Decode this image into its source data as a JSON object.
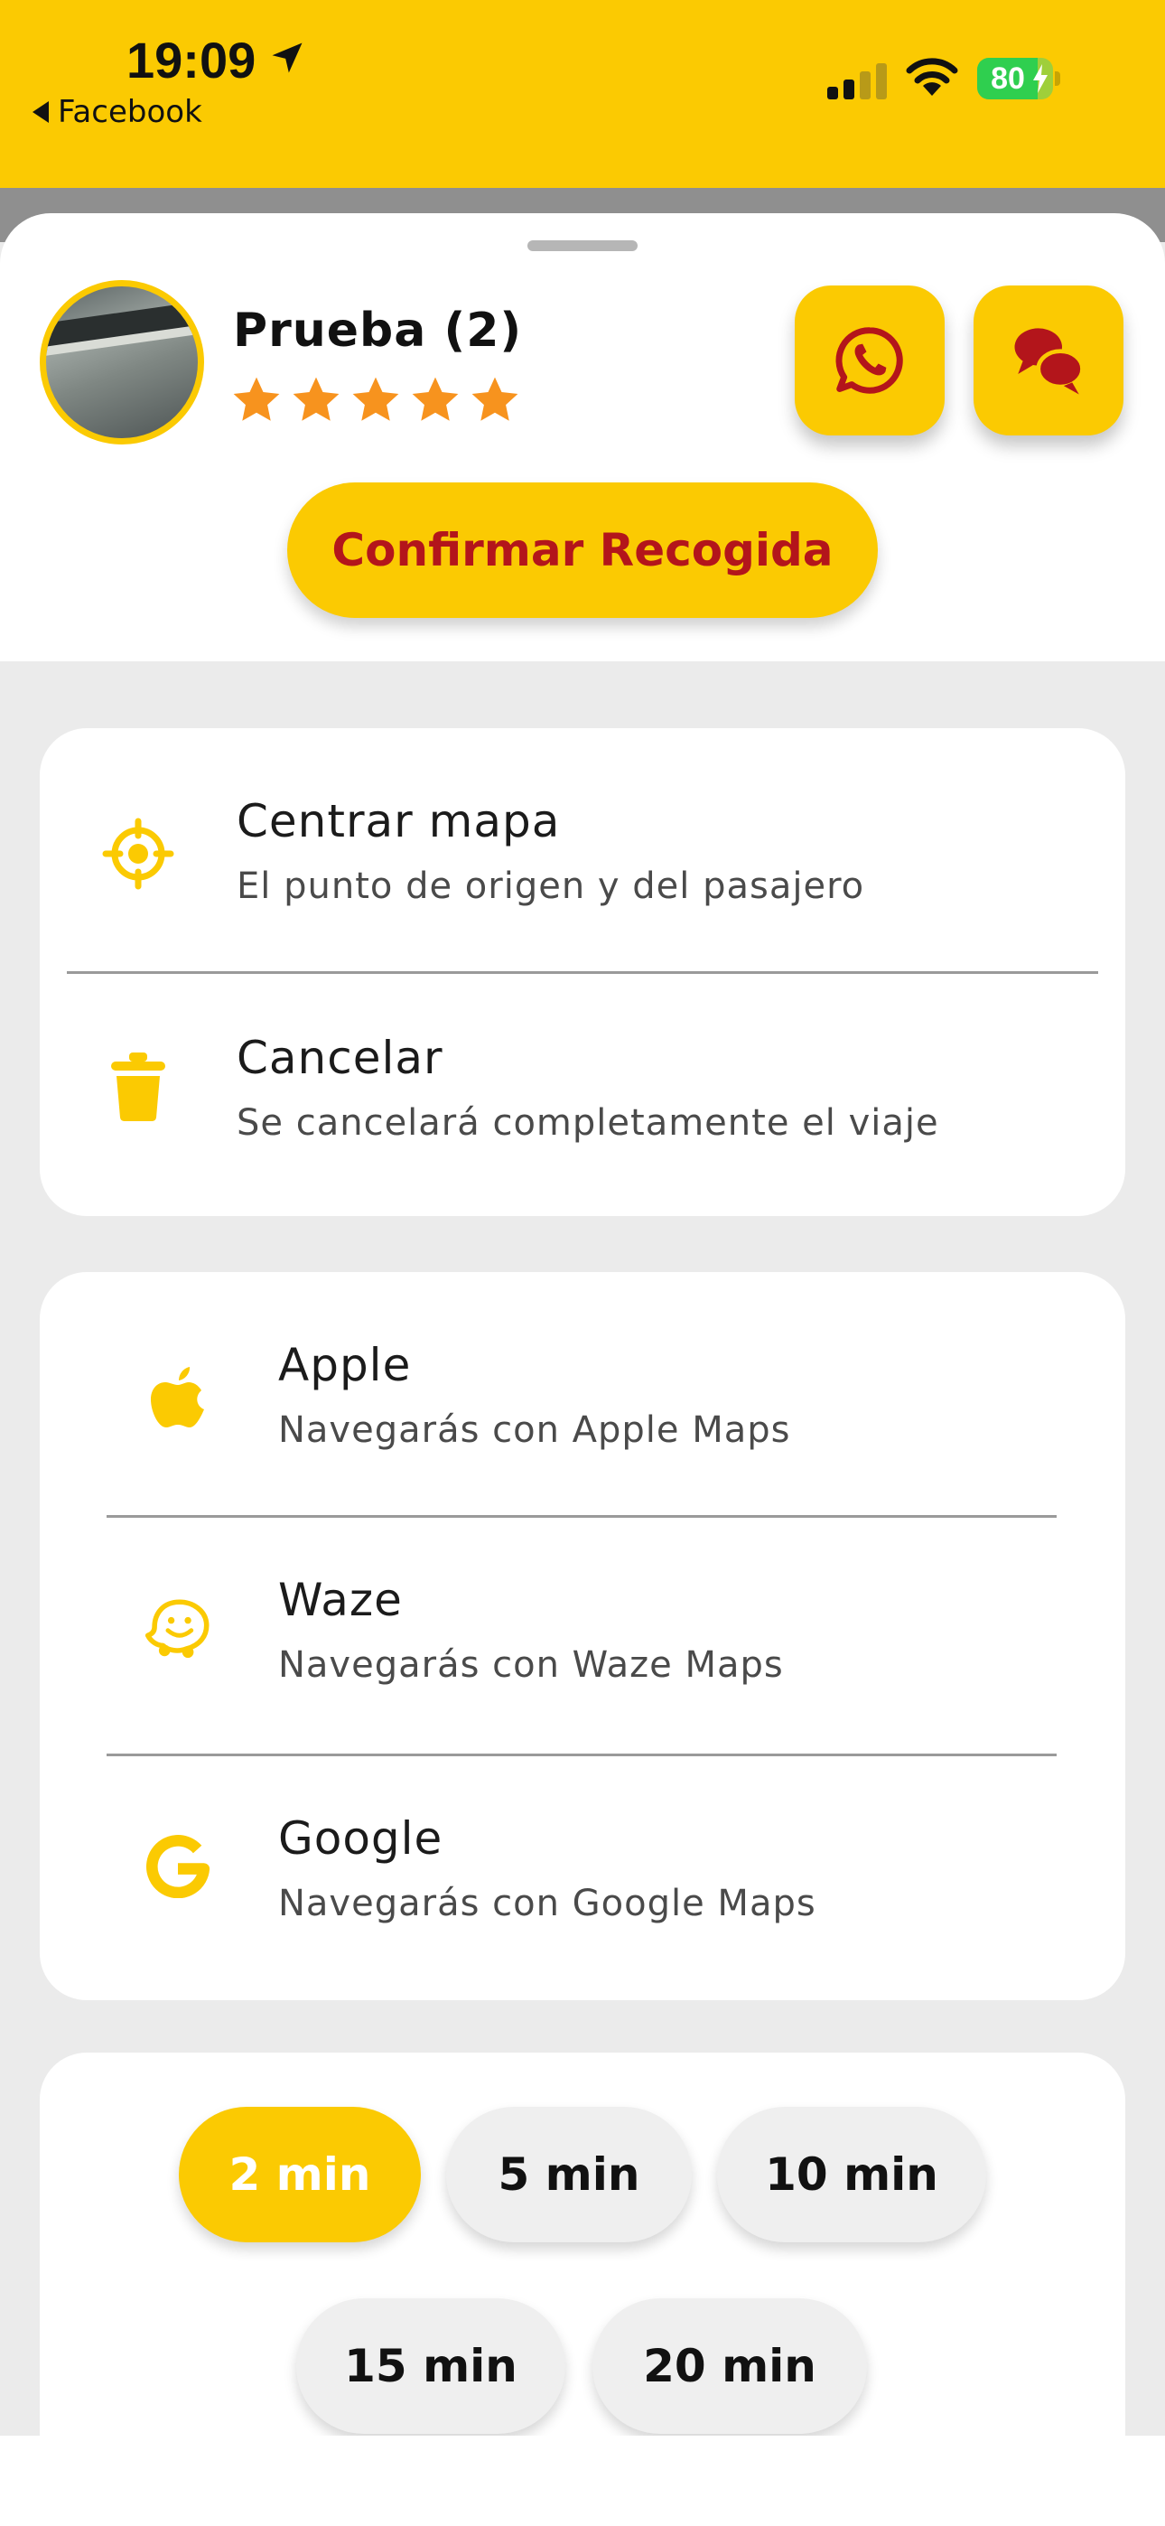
{
  "status_bar": {
    "time": "19:09",
    "back_label": "Facebook",
    "battery_level": "80",
    "battery_fraction": 0.8,
    "signal_bars_active": 2,
    "signal_bars_total": 4,
    "icons": [
      "location-arrow-icon",
      "signal-icon",
      "wifi-icon",
      "battery-icon"
    ]
  },
  "driver_panel": {
    "name": "Prueba (2)",
    "rating": 5,
    "rating_max": 5,
    "whatsapp_icon": "whatsapp-icon",
    "chat_icon": "chat-bubbles-icon",
    "confirm_label": "Confirmar Recogida"
  },
  "actions": [
    {
      "icon": "crosshair-icon",
      "title": "Centrar mapa",
      "subtitle": "El punto de origen y del pasajero"
    },
    {
      "icon": "trash-icon",
      "title": "Cancelar",
      "subtitle": "Se cancelará completamente el viaje"
    }
  ],
  "navigation": [
    {
      "icon": "apple-icon",
      "title": "Apple",
      "subtitle": "Navegarás con Apple Maps"
    },
    {
      "icon": "waze-icon",
      "title": "Waze",
      "subtitle": "Navegarás con Waze Maps"
    },
    {
      "icon": "google-icon",
      "title": "Google",
      "subtitle": "Navegarás con Google Maps"
    }
  ],
  "time_options": {
    "options": [
      "2 min",
      "5 min",
      "10 min",
      "15 min",
      "20 min"
    ],
    "selected": "2 min"
  },
  "colors": {
    "accent": "#fbca02",
    "confirm_text": "#b3151b",
    "icon_red": "#b3151b",
    "star": "#f7931e",
    "background": "#ebebeb"
  }
}
